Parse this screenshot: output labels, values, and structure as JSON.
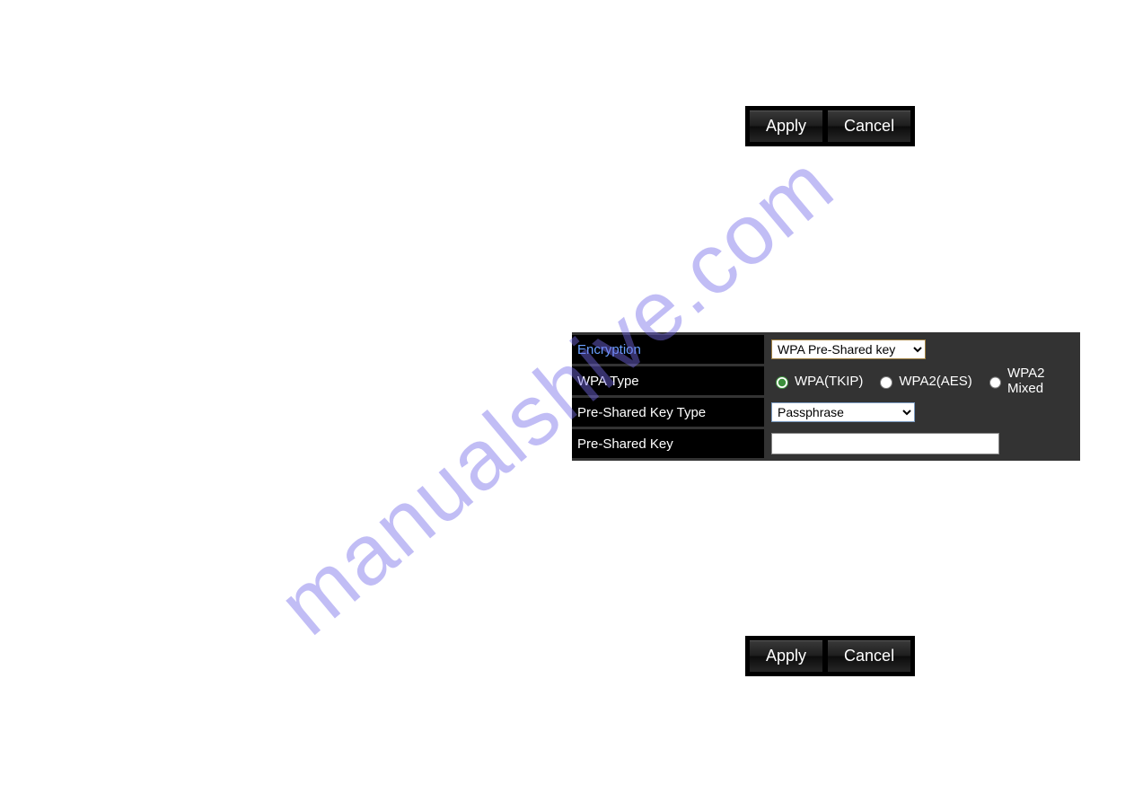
{
  "watermark": "manualshive.com",
  "buttons_top": {
    "apply": "Apply",
    "cancel": "Cancel"
  },
  "buttons_bottom": {
    "apply": "Apply",
    "cancel": "Cancel"
  },
  "form": {
    "encryption": {
      "label": "Encryption",
      "selected": "WPA Pre-Shared key"
    },
    "wpa_type": {
      "label": "WPA Type",
      "options": [
        {
          "value": "tkip",
          "label": "WPA(TKIP)",
          "checked": true
        },
        {
          "value": "aes",
          "label": "WPA2(AES)",
          "checked": false
        },
        {
          "value": "mixed",
          "label": "WPA2 Mixed",
          "checked": false
        }
      ]
    },
    "psk_type": {
      "label": "Pre-Shared Key Type",
      "selected": "Passphrase"
    },
    "psk": {
      "label": "Pre-Shared Key",
      "value": ""
    }
  }
}
